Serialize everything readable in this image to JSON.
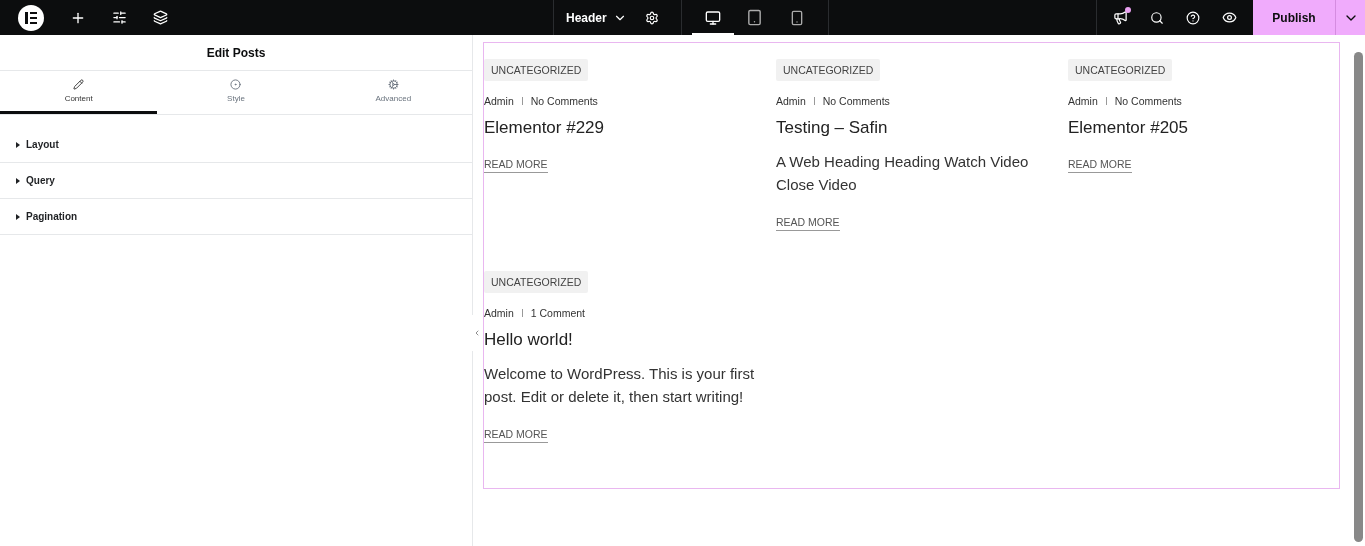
{
  "topbar": {
    "document": "Header",
    "devices": [
      {
        "kind": "desktop",
        "selected": true
      },
      {
        "kind": "tablet",
        "selected": false
      },
      {
        "kind": "mobile",
        "selected": false
      }
    ],
    "notification": true,
    "publish": "Publish"
  },
  "panel": {
    "title": "Edit Posts",
    "tabs": [
      {
        "kind": "content",
        "label": "Content",
        "selected": true
      },
      {
        "kind": "style",
        "label": "Style",
        "selected": false
      },
      {
        "kind": "advanced",
        "label": "Advanced",
        "selected": false
      }
    ],
    "sections": [
      {
        "label": "Layout",
        "expanded": false
      },
      {
        "label": "Query",
        "expanded": false
      },
      {
        "label": "Pagination",
        "expanded": false
      }
    ]
  },
  "posts": [
    {
      "category": "UNCATEGORIZED",
      "author": "Admin",
      "comments": "No Comments",
      "title": "Elementor #229",
      "read_more": "READ MORE"
    },
    {
      "category": "UNCATEGORIZED",
      "author": "Admin",
      "comments": "No Comments",
      "title": "Testing – Safin",
      "excerpt": "A Web Heading Heading Watch Video Close Video",
      "read_more": "READ MORE"
    },
    {
      "category": "UNCATEGORIZED",
      "author": "Admin",
      "comments": "No Comments",
      "title": "Elementor #205",
      "read_more": "READ MORE"
    },
    {
      "category": "UNCATEGORIZED",
      "author": "Admin",
      "comments": "1 Comment",
      "title": "Hello world!",
      "excerpt": "Welcome to WordPress. This is your first post. Edit or delete it, then start writing!",
      "read_more": "READ MORE"
    }
  ]
}
